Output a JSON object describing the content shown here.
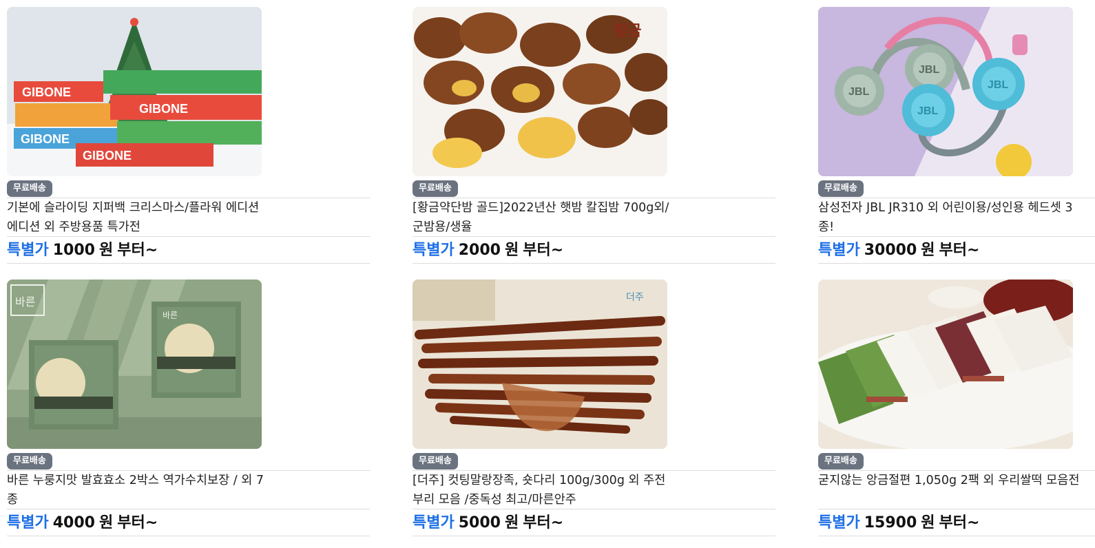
{
  "products": [
    {
      "badge": "무료배송",
      "title": "기본에 슬라이딩 지퍼백 크리스마스/플라워 에디션 에디션 외 주방용품 특가전",
      "price_label": "특별가",
      "price": "1000",
      "currency": "원",
      "suffix": "부터~",
      "image_text": "GIBONE"
    },
    {
      "badge": "무료배송",
      "title": "[황금약단밤 골드]2022년산 햇밤 칼집밤 700g외/군밤용/생율",
      "price_label": "특별가",
      "price": "2000",
      "currency": "원",
      "suffix": "부터~",
      "image_text": "황금"
    },
    {
      "badge": "무료배송",
      "title": "삼성전자 JBL JR310 외 어린이용/성인용 헤드셋 3종!",
      "price_label": "특별가",
      "price": "30000",
      "currency": "원",
      "suffix": "부터~",
      "image_text": "JBL"
    },
    {
      "badge": "무료배송",
      "title": "바른 누룽지맛 발효효소 2박스 역가수치보장 / 외 7종",
      "price_label": "특별가",
      "price": "4000",
      "currency": "원",
      "suffix": "부터~",
      "image_text": "바른"
    },
    {
      "badge": "무료배송",
      "title": "[더주] 컷팅말랑장족, 숏다리 100g/300g 외 주전부리 모음 /중독성 최고/마른안주",
      "price_label": "특별가",
      "price": "5000",
      "currency": "원",
      "suffix": "부터~",
      "image_text": "더주"
    },
    {
      "badge": "무료배송",
      "title": "굳지않는 앙금절편 1,050g 2팩 외 우리쌀떡 모음전",
      "price_label": "특별가",
      "price": "15900",
      "currency": "원",
      "suffix": "부터~",
      "image_text": ""
    }
  ]
}
